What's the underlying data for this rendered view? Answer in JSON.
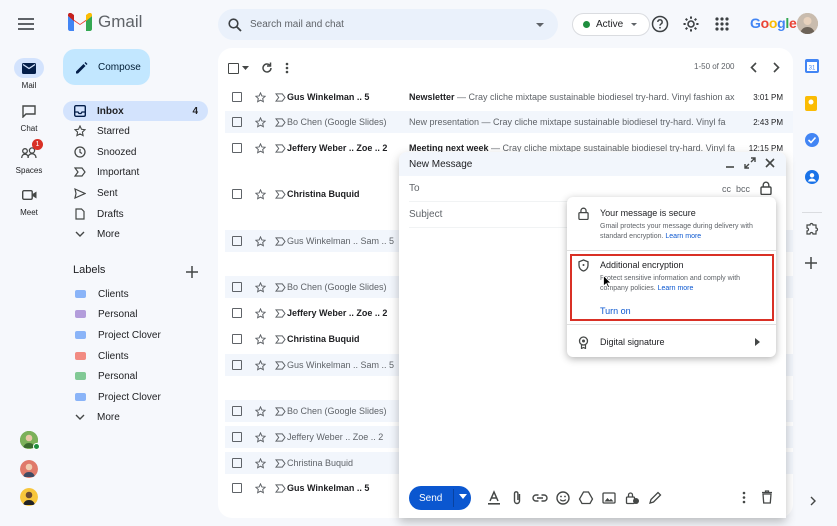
{
  "app": {
    "name": "Gmail"
  },
  "search": {
    "placeholder": "Search mail and chat"
  },
  "status": {
    "label": "Active"
  },
  "brand": {
    "google": "Google"
  },
  "rail": [
    {
      "label": "Mail",
      "icon": "mail-icon"
    },
    {
      "label": "Chat",
      "icon": "chat-icon"
    },
    {
      "label": "Spaces",
      "icon": "spaces-icon",
      "badge": "1"
    },
    {
      "label": "Meet",
      "icon": "meet-icon"
    }
  ],
  "compose": {
    "label": "Compose"
  },
  "nav": [
    {
      "label": "Inbox",
      "icon": "inbox-icon",
      "count": "4",
      "selected": true
    },
    {
      "label": "Starred",
      "icon": "star-icon"
    },
    {
      "label": "Snoozed",
      "icon": "clock-icon"
    },
    {
      "label": "Important",
      "icon": "important-icon"
    },
    {
      "label": "Sent",
      "icon": "send-icon"
    },
    {
      "label": "Drafts",
      "icon": "draft-icon"
    },
    {
      "label": "More",
      "icon": "chevron-down-icon"
    }
  ],
  "labels": {
    "heading": "Labels",
    "items": [
      {
        "label": "Clients",
        "color": "#8ab4f8"
      },
      {
        "label": "Personal",
        "color": "#b39ddb"
      },
      {
        "label": "Project Clover",
        "color": "#8ab4f8"
      },
      {
        "label": "Clients",
        "color": "#f28b82"
      },
      {
        "label": "Personal",
        "color": "#81c995"
      },
      {
        "label": "Project Clover",
        "color": "#8ab4f8"
      }
    ],
    "more": "More"
  },
  "list": {
    "pager": "1-50 of 200",
    "rows": [
      {
        "sender": "Gus Winkelman .. 5",
        "subject": "Newsletter",
        "snippet": " — Cray cliche mixtape sustainable biodiesel try-hard. Vinyl fashion ax",
        "time": "3:01 PM",
        "unread": true
      },
      {
        "sender": "Bo Chen (Google Slides)",
        "subject": "",
        "snippet": "New presentation — Cray cliche mixtape sustainable biodiesel try-hard. Vinyl fa",
        "time": "2:43 PM",
        "unread": false
      },
      {
        "sender": "Jeffery Weber .. Zoe .. 2",
        "subject": "Meeting next week",
        "snippet": " — Cray cliche mixtape sustainable biodiesel try-hard. Vinyl fa",
        "time": "12:15 PM",
        "unread": true
      },
      {
        "sender": "Christina Buquid",
        "subject": "",
        "snippet": "",
        "time": "",
        "unread": true
      },
      {
        "sender": "Gus Winkelman .. Sam .. 5",
        "subject": "",
        "snippet": "",
        "time": "",
        "unread": false
      },
      {
        "sender": "Bo Chen (Google Slides)",
        "subject": "",
        "snippet": "",
        "time": "",
        "unread": false
      },
      {
        "sender": "Jeffery Weber .. Zoe .. 2",
        "subject": "",
        "snippet": "",
        "time": "",
        "unread": true
      },
      {
        "sender": "Christina Buquid",
        "subject": "",
        "snippet": "",
        "time": "",
        "unread": true
      },
      {
        "sender": "Gus Winkelman .. Sam .. 5",
        "subject": "",
        "snippet": "",
        "time": "",
        "unread": false
      },
      {
        "sender": "Bo Chen (Google Slides)",
        "subject": "",
        "snippet": "",
        "time": "",
        "unread": false
      },
      {
        "sender": "Jeffery Weber .. Zoe .. 2",
        "subject": "",
        "snippet": "",
        "time": "",
        "unread": false
      },
      {
        "sender": "Christina Buquid",
        "subject": "",
        "snippet": "",
        "time": "",
        "unread": false
      },
      {
        "sender": "Gus Winkelman .. 5",
        "subject": "",
        "snippet": "",
        "time": "",
        "unread": true
      }
    ]
  },
  "composeWindow": {
    "title": "New Message",
    "to": "To",
    "cc": "cc",
    "bcc": "bcc",
    "subject": "Subject",
    "send": "Send"
  },
  "popup": {
    "secure": {
      "title": "Your message is secure",
      "desc": "Gmail protects your message during delivery with standard encryption.",
      "link": "Learn more"
    },
    "additional": {
      "title": "Additional encryption",
      "desc": "Protect sensitive information and comply with company policies.",
      "link": "Learn more",
      "action": "Turn on"
    },
    "signature": {
      "title": "Digital signature"
    }
  },
  "colors": {
    "accent": "#0b57d0",
    "highlight": "#d93025",
    "selectedNav": "#d3e3fd",
    "compose": "#c2e7ff"
  }
}
